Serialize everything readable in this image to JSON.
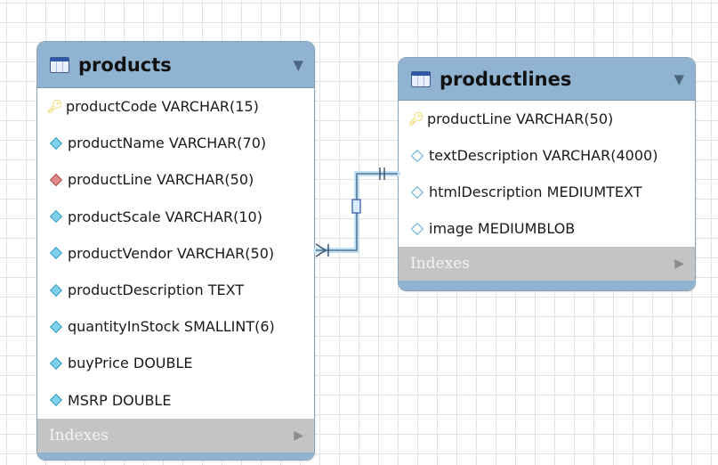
{
  "tables": [
    {
      "title": "products",
      "columns": [
        {
          "text": "productCode VARCHAR(15)",
          "icon": "key-icon"
        },
        {
          "text": "productName VARCHAR(70)",
          "icon": "column-diamond-icon"
        },
        {
          "text": "productLine VARCHAR(50)",
          "icon": "foreign-key-diamond-icon"
        },
        {
          "text": "productScale VARCHAR(10)",
          "icon": "column-diamond-icon"
        },
        {
          "text": "productVendor VARCHAR(50)",
          "icon": "column-diamond-icon"
        },
        {
          "text": "productDescription TEXT",
          "icon": "column-diamond-icon"
        },
        {
          "text": "quantityInStock SMALLINT(6)",
          "icon": "column-diamond-icon"
        },
        {
          "text": "buyPrice DOUBLE",
          "icon": "column-diamond-icon"
        },
        {
          "text": "MSRP DOUBLE",
          "icon": "column-diamond-icon"
        }
      ],
      "indexes_label": "Indexes"
    },
    {
      "title": "productlines",
      "columns": [
        {
          "text": "productLine VARCHAR(50)",
          "icon": "key-icon"
        },
        {
          "text": "textDescription VARCHAR(4000)",
          "icon": "nullable-diamond-icon"
        },
        {
          "text": "htmlDescription MEDIUMTEXT",
          "icon": "nullable-diamond-icon"
        },
        {
          "text": "image MEDIUMBLOB",
          "icon": "nullable-diamond-icon"
        }
      ],
      "indexes_label": "Indexes"
    }
  ],
  "colors": {
    "header": "#8fb3d1",
    "indexes_bar": "#c4c4c4",
    "relationship_line": "#5a7590",
    "relationship_glow": "#bfe3f5"
  }
}
